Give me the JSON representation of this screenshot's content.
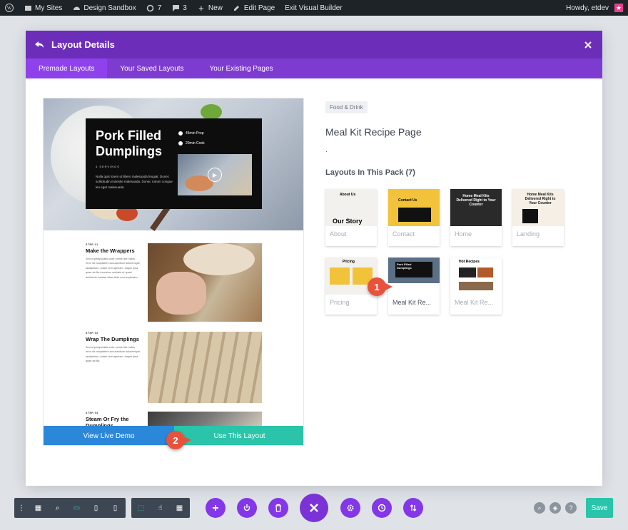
{
  "adminbar": {
    "my_sites": "My Sites",
    "site_name": "Design Sandbox",
    "updates_count": "7",
    "comments_count": "3",
    "new_label": "New",
    "edit_page": "Edit Page",
    "exit_builder": "Exit Visual Builder",
    "howdy": "Howdy, etdev"
  },
  "modal": {
    "title": "Layout Details",
    "tabs": [
      {
        "label": "Premade Layouts",
        "active": true
      },
      {
        "label": "Your Saved Layouts",
        "active": false
      },
      {
        "label": "Your Existing Pages",
        "active": false
      }
    ]
  },
  "preview": {
    "hero_title": "Pork Filled Dumplings",
    "servings": "4 SERVINGS",
    "hero_desc": "Nulla quis lorem ut libero malesuada feugiat. Donec sollicitudin molestie malesuada. Donec rutrum congue leo eget malesuada.",
    "prep": "45min Prep",
    "cook": "20min Cook",
    "steps": [
      {
        "label": "STEP-01",
        "heading": "Make the Wrappers",
        "body": "Sed ut perspiciatis unde omnis iste natus error sit voluptatem accusantium doloremque laudantium, totam rem aperiam, eaque ipsa quae ab illo inventore veritatis et quasi architecto beatae vitae dicta sunt explicabo."
      },
      {
        "label": "STEP-02",
        "heading": "Wrap The Dumplings",
        "body": "Sed ut perspiciatis unde omnis iste natus error sit voluptatem accusantium doloremque laudantium, totam rem aperiam, eaque ipsa quae ab illo."
      },
      {
        "label": "STEP-03",
        "heading": "Steam Or Fry the Dumplings",
        "body": ""
      }
    ],
    "btn_demo": "View Live Demo",
    "btn_use": "Use This Layout"
  },
  "info": {
    "tag": "Food & Drink",
    "name": "Meal Kit Recipe Page",
    "description": ".",
    "pack_title": "Layouts In This Pack (7)"
  },
  "thumbs": [
    {
      "label": "About",
      "mini": "About Us",
      "mini2": "Our Story"
    },
    {
      "label": "Contact",
      "mini": "Contact Us",
      "mini2": ""
    },
    {
      "label": "Home",
      "mini": "Home Meal Kits Delivered Right to Your Counter",
      "mini2": ""
    },
    {
      "label": "Landing",
      "mini": "Home Meal Kits Delivered Right to Your Counter",
      "mini2": ""
    },
    {
      "label": "Pricing",
      "mini": "Pricing",
      "mini2": ""
    },
    {
      "label": "Meal Kit Re...",
      "mini": "Pork Filled Dumplings",
      "mini2": ""
    },
    {
      "label": "Meal Kit Re...",
      "mini": "Hot Recipes",
      "mini2": ""
    }
  ],
  "callouts": {
    "first": "1",
    "second": "2"
  },
  "toolbar": {
    "save_label": "Save"
  },
  "colors": {
    "purple_header": "#6c2eb9",
    "purple_tabs": "#7e3bd0",
    "demo_blue": "#2b87da",
    "use_teal": "#29c4a9",
    "callout_red": "#e8523d"
  }
}
